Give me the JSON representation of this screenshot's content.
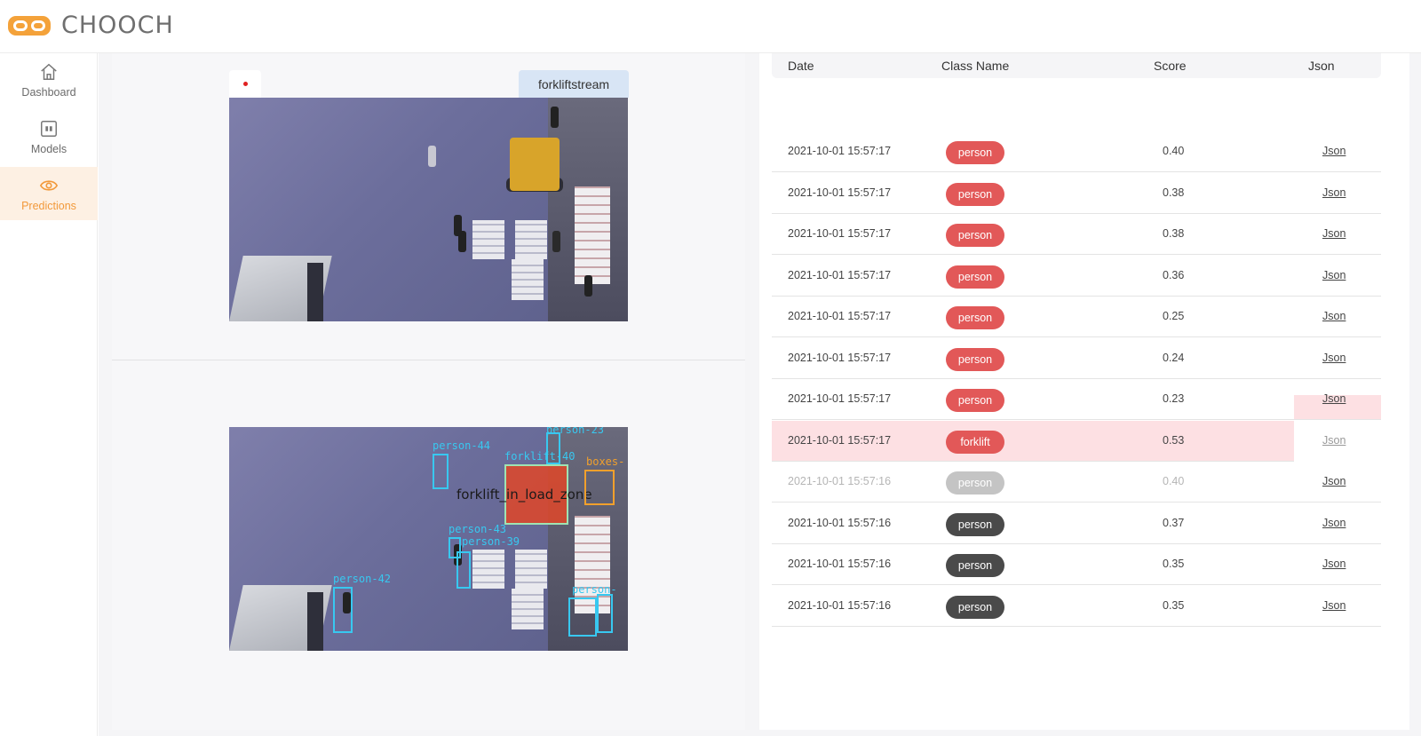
{
  "brand": {
    "name": "CHOOCH",
    "accent": "#f4a23a"
  },
  "sidebar": {
    "items": [
      {
        "label": "Dashboard",
        "icon": "home-icon",
        "active": false
      },
      {
        "label": "Models",
        "icon": "models-icon",
        "active": false
      },
      {
        "label": "Predictions",
        "icon": "eye-icon",
        "active": true
      }
    ]
  },
  "stream": {
    "tab_label": "forkliftstream",
    "live_indicator_color": "#e02020"
  },
  "detections": {
    "zone_label": "forklift_in_load_zone",
    "labels": [
      "person-44",
      "forklift-40",
      "person-23",
      "boxes-",
      "person-43",
      "person-39",
      "person-42",
      "person-"
    ]
  },
  "table": {
    "columns": [
      "Date",
      "Class Name",
      "Score",
      "Json"
    ],
    "rows": [
      {
        "date": "2021-10-01 15:57:17",
        "class": "person",
        "score": "0.40",
        "json": "Json",
        "pill_color": "#e25858",
        "state": "normal"
      },
      {
        "date": "2021-10-01 15:57:17",
        "class": "person",
        "score": "0.38",
        "json": "Json",
        "pill_color": "#e25858",
        "state": "normal"
      },
      {
        "date": "2021-10-01 15:57:17",
        "class": "person",
        "score": "0.38",
        "json": "Json",
        "pill_color": "#e25858",
        "state": "normal"
      },
      {
        "date": "2021-10-01 15:57:17",
        "class": "person",
        "score": "0.36",
        "json": "Json",
        "pill_color": "#e25858",
        "state": "normal"
      },
      {
        "date": "2021-10-01 15:57:17",
        "class": "person",
        "score": "0.25",
        "json": "Json",
        "pill_color": "#e25858",
        "state": "normal"
      },
      {
        "date": "2021-10-01 15:57:17",
        "class": "person",
        "score": "0.24",
        "json": "Json",
        "pill_color": "#e25858",
        "state": "normal"
      },
      {
        "date": "2021-10-01 15:57:17",
        "class": "person",
        "score": "0.23",
        "json": "Json",
        "pill_color": "#e25858",
        "state": "normal"
      },
      {
        "date": "2021-10-01 15:57:17",
        "class": "forklift",
        "score": "0.53",
        "json": "Json",
        "pill_color": "#e25858",
        "state": "highlighted"
      },
      {
        "date": "2021-10-01 15:57:16",
        "class": "person",
        "score": "0.40",
        "json": "Json",
        "pill_color": "#c4c4c4",
        "state": "faded"
      },
      {
        "date": "2021-10-01 15:57:16",
        "class": "person",
        "score": "0.37",
        "json": "Json",
        "pill_color": "#4a4a4a",
        "state": "normal"
      },
      {
        "date": "2021-10-01 15:57:16",
        "class": "person",
        "score": "0.35",
        "json": "Json",
        "pill_color": "#4a4a4a",
        "state": "normal"
      },
      {
        "date": "2021-10-01 15:57:16",
        "class": "person",
        "score": "0.35",
        "json": "Json",
        "pill_color": "#4a4a4a",
        "state": "normal"
      }
    ]
  }
}
